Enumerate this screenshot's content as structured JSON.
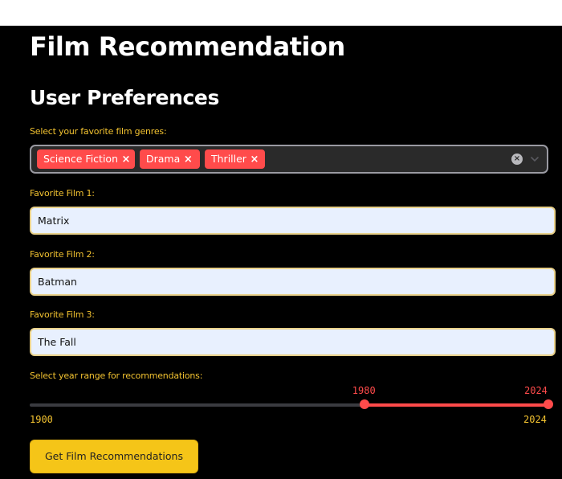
{
  "page": {
    "title": "Film Recommendation",
    "subtitle": "User Preferences"
  },
  "genres": {
    "label": "Select your favorite film genres:",
    "selected": [
      "Science Fiction",
      "Drama",
      "Thriller"
    ],
    "remove_glyph": "×",
    "clear_glyph": "×",
    "chip_color": "#ff4b4b"
  },
  "films": [
    {
      "label": "Favorite Film 1:",
      "value": "Matrix"
    },
    {
      "label": "Favorite Film 2:",
      "value": "Batman"
    },
    {
      "label": "Favorite Film 3:",
      "value": "The Fall"
    }
  ],
  "year_range": {
    "label": "Select year range for recommendations:",
    "min": 1900,
    "max": 2024,
    "low": 1980,
    "high": 2024,
    "min_label": "1900",
    "max_label": "2024",
    "low_label": "1980",
    "high_label": "2024",
    "accent": "#ff4b4b"
  },
  "actions": {
    "submit_label": "Get Film Recommendations"
  },
  "theme": {
    "label_color": "#f2c230",
    "button_color": "#f5c518",
    "background": "#000000"
  }
}
